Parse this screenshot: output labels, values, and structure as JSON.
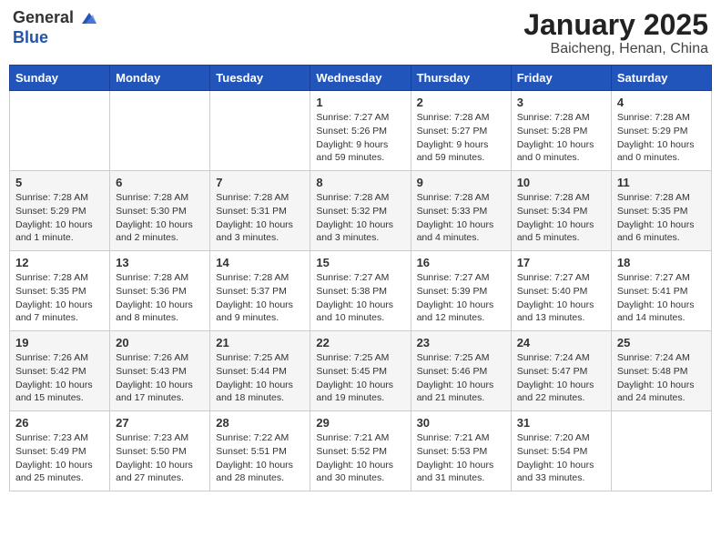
{
  "header": {
    "logo_general": "General",
    "logo_blue": "Blue",
    "month": "January 2025",
    "location": "Baicheng, Henan, China"
  },
  "weekdays": [
    "Sunday",
    "Monday",
    "Tuesday",
    "Wednesday",
    "Thursday",
    "Friday",
    "Saturday"
  ],
  "weeks": [
    [
      {
        "day": "",
        "info": ""
      },
      {
        "day": "",
        "info": ""
      },
      {
        "day": "",
        "info": ""
      },
      {
        "day": "1",
        "info": "Sunrise: 7:27 AM\nSunset: 5:26 PM\nDaylight: 9 hours and 59 minutes."
      },
      {
        "day": "2",
        "info": "Sunrise: 7:28 AM\nSunset: 5:27 PM\nDaylight: 9 hours and 59 minutes."
      },
      {
        "day": "3",
        "info": "Sunrise: 7:28 AM\nSunset: 5:28 PM\nDaylight: 10 hours and 0 minutes."
      },
      {
        "day": "4",
        "info": "Sunrise: 7:28 AM\nSunset: 5:29 PM\nDaylight: 10 hours and 0 minutes."
      }
    ],
    [
      {
        "day": "5",
        "info": "Sunrise: 7:28 AM\nSunset: 5:29 PM\nDaylight: 10 hours and 1 minute."
      },
      {
        "day": "6",
        "info": "Sunrise: 7:28 AM\nSunset: 5:30 PM\nDaylight: 10 hours and 2 minutes."
      },
      {
        "day": "7",
        "info": "Sunrise: 7:28 AM\nSunset: 5:31 PM\nDaylight: 10 hours and 3 minutes."
      },
      {
        "day": "8",
        "info": "Sunrise: 7:28 AM\nSunset: 5:32 PM\nDaylight: 10 hours and 3 minutes."
      },
      {
        "day": "9",
        "info": "Sunrise: 7:28 AM\nSunset: 5:33 PM\nDaylight: 10 hours and 4 minutes."
      },
      {
        "day": "10",
        "info": "Sunrise: 7:28 AM\nSunset: 5:34 PM\nDaylight: 10 hours and 5 minutes."
      },
      {
        "day": "11",
        "info": "Sunrise: 7:28 AM\nSunset: 5:35 PM\nDaylight: 10 hours and 6 minutes."
      }
    ],
    [
      {
        "day": "12",
        "info": "Sunrise: 7:28 AM\nSunset: 5:35 PM\nDaylight: 10 hours and 7 minutes."
      },
      {
        "day": "13",
        "info": "Sunrise: 7:28 AM\nSunset: 5:36 PM\nDaylight: 10 hours and 8 minutes."
      },
      {
        "day": "14",
        "info": "Sunrise: 7:28 AM\nSunset: 5:37 PM\nDaylight: 10 hours and 9 minutes."
      },
      {
        "day": "15",
        "info": "Sunrise: 7:27 AM\nSunset: 5:38 PM\nDaylight: 10 hours and 10 minutes."
      },
      {
        "day": "16",
        "info": "Sunrise: 7:27 AM\nSunset: 5:39 PM\nDaylight: 10 hours and 12 minutes."
      },
      {
        "day": "17",
        "info": "Sunrise: 7:27 AM\nSunset: 5:40 PM\nDaylight: 10 hours and 13 minutes."
      },
      {
        "day": "18",
        "info": "Sunrise: 7:27 AM\nSunset: 5:41 PM\nDaylight: 10 hours and 14 minutes."
      }
    ],
    [
      {
        "day": "19",
        "info": "Sunrise: 7:26 AM\nSunset: 5:42 PM\nDaylight: 10 hours and 15 minutes."
      },
      {
        "day": "20",
        "info": "Sunrise: 7:26 AM\nSunset: 5:43 PM\nDaylight: 10 hours and 17 minutes."
      },
      {
        "day": "21",
        "info": "Sunrise: 7:25 AM\nSunset: 5:44 PM\nDaylight: 10 hours and 18 minutes."
      },
      {
        "day": "22",
        "info": "Sunrise: 7:25 AM\nSunset: 5:45 PM\nDaylight: 10 hours and 19 minutes."
      },
      {
        "day": "23",
        "info": "Sunrise: 7:25 AM\nSunset: 5:46 PM\nDaylight: 10 hours and 21 minutes."
      },
      {
        "day": "24",
        "info": "Sunrise: 7:24 AM\nSunset: 5:47 PM\nDaylight: 10 hours and 22 minutes."
      },
      {
        "day": "25",
        "info": "Sunrise: 7:24 AM\nSunset: 5:48 PM\nDaylight: 10 hours and 24 minutes."
      }
    ],
    [
      {
        "day": "26",
        "info": "Sunrise: 7:23 AM\nSunset: 5:49 PM\nDaylight: 10 hours and 25 minutes."
      },
      {
        "day": "27",
        "info": "Sunrise: 7:23 AM\nSunset: 5:50 PM\nDaylight: 10 hours and 27 minutes."
      },
      {
        "day": "28",
        "info": "Sunrise: 7:22 AM\nSunset: 5:51 PM\nDaylight: 10 hours and 28 minutes."
      },
      {
        "day": "29",
        "info": "Sunrise: 7:21 AM\nSunset: 5:52 PM\nDaylight: 10 hours and 30 minutes."
      },
      {
        "day": "30",
        "info": "Sunrise: 7:21 AM\nSunset: 5:53 PM\nDaylight: 10 hours and 31 minutes."
      },
      {
        "day": "31",
        "info": "Sunrise: 7:20 AM\nSunset: 5:54 PM\nDaylight: 10 hours and 33 minutes."
      },
      {
        "day": "",
        "info": ""
      }
    ]
  ]
}
